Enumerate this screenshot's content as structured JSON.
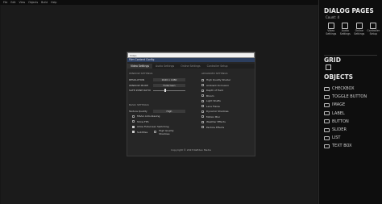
{
  "menubar": {
    "items": [
      "File",
      "Edit",
      "View",
      "Objects",
      "Build",
      "Help"
    ]
  },
  "dialog_panel": {
    "title": "DIALOG PAGES",
    "count": "Count: 4",
    "items": [
      {
        "label": "Video Settings",
        "icon": "monitor-icon"
      },
      {
        "label": "Audio Settings",
        "icon": "speaker-icon"
      },
      {
        "label": "Online Settings",
        "icon": "globe-icon"
      },
      {
        "label": "Controller Setup",
        "icon": "gamepad-icon"
      }
    ]
  },
  "grid": {
    "title": "GRID"
  },
  "objects": {
    "title": "OBJECTS",
    "items": [
      {
        "label": "CHECKBOX",
        "icon": "checkbox-icon"
      },
      {
        "label": "TOGGLE BUTTON",
        "icon": "toggle-icon"
      },
      {
        "label": "IMAGE",
        "icon": "image-icon"
      },
      {
        "label": "LABEL",
        "icon": "label-icon"
      },
      {
        "label": "BUTTON",
        "icon": "button-icon"
      },
      {
        "label": "SLIDER",
        "icon": "slider-icon"
      },
      {
        "label": "LIST",
        "icon": "list-icon"
      },
      {
        "label": "TEXT BOX",
        "icon": "textbox-icon"
      }
    ]
  },
  "dialog": {
    "search_value": "Video",
    "header": "Film Content Config",
    "tabs": [
      "Video Settings",
      "Audio Settings",
      "Online Settings",
      "Controller Setup"
    ],
    "window_section": "WINDOW SETTINGS",
    "window_rows": [
      {
        "label": "RESOLUTION",
        "value": "1920 x 1080"
      },
      {
        "label": "WINDOW MODE",
        "value": "Fullscreen"
      },
      {
        "label": "SAFE ZONE RATIO",
        "value": ""
      }
    ],
    "safe_zone_level": 0.35,
    "basic_section": "BASIC SETTINGS",
    "texture_label": "Texture Quality",
    "texture_value": "High",
    "basic_checks": [
      {
        "label": "MSAA Anti-Aliasing",
        "on": false
      },
      {
        "label": "Show FPS",
        "on": false
      },
      {
        "label": "Allow Fullscreen Switching",
        "on": true
      }
    ],
    "bottom_checks": [
      {
        "label": "Subtitles",
        "on": true
      },
      {
        "label": "High Quality Shadows",
        "on": false
      }
    ],
    "advanced_section": "ADVANCED SETTINGS",
    "advanced_checks": [
      "High Quality Shader",
      "Ambient Occlusion",
      "Depth of Field",
      "Bloom",
      "Light Shafts",
      "Lens Flares",
      "Dynamic Shadows",
      "Motion Blur",
      "Weather Effects",
      "Particle Effects"
    ],
    "footer": "Copyright © 2023 Nafideo Media"
  }
}
